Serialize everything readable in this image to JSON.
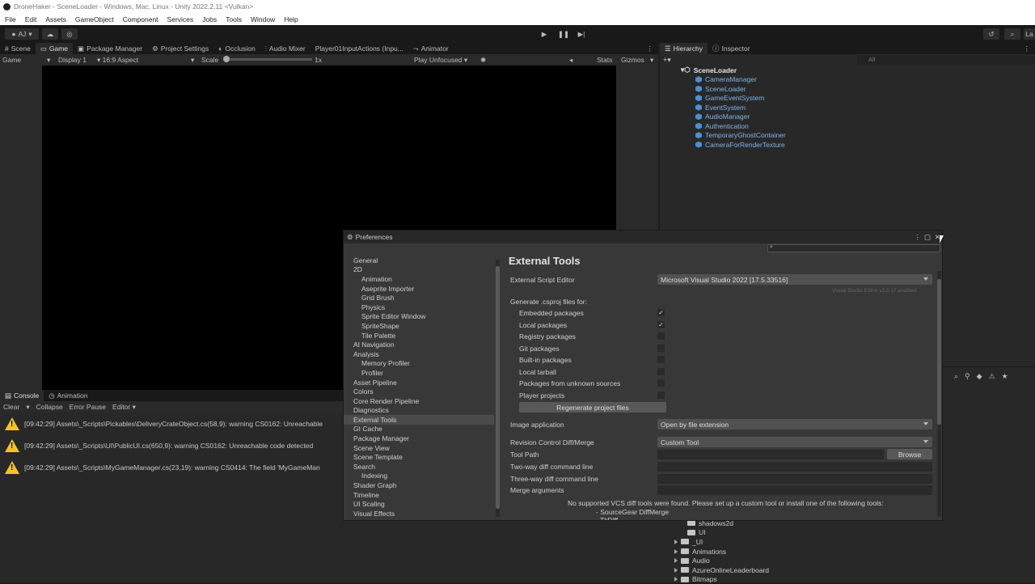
{
  "window": {
    "title": "DroneHaker - SceneLoader - Windows, Mac, Linux - Unity 2022.2.11 <Vulkan>"
  },
  "menu": [
    "File",
    "Edit",
    "Assets",
    "GameObject",
    "Component",
    "Services",
    "Jobs",
    "Tools",
    "Window",
    "Help"
  ],
  "toolbar": {
    "account": "AJ",
    "cloud_icon": "cloud-icon",
    "collab_icon": "collab-icon",
    "history_icon": "history-icon",
    "search_icon": "search-icon",
    "layers": "La"
  },
  "left_tabs": [
    {
      "label": "Scene",
      "icon": "scene-icon"
    },
    {
      "label": "Game",
      "icon": "game-icon"
    },
    {
      "label": "Package Manager",
      "icon": "package-icon"
    },
    {
      "label": "Project Settings",
      "icon": "gear-icon"
    },
    {
      "label": "Occlusion",
      "icon": "occlusion-icon"
    },
    {
      "label": "Audio Mixer",
      "icon": "mixer-icon"
    },
    {
      "label": "Player01InputActions (Inpu...",
      "icon": ""
    },
    {
      "label": "Animator",
      "icon": "animator-icon"
    }
  ],
  "game_bar": {
    "mode": "Game",
    "display": "Display 1",
    "aspect": "16:9 Aspect",
    "scale_label": "Scale",
    "scale_value": "1x",
    "play_mode": "Play Unfocused",
    "stats": "Stats",
    "gizmos": "Gizmos"
  },
  "hierarchy": {
    "tab": "Hierarchy",
    "inspector_tab": "Inspector",
    "search_placeholder": "All",
    "root": "SceneLoader",
    "items": [
      "CameraManager",
      "SceneLoader",
      "GameEventSystem",
      "EventSystem",
      "AudioManager",
      "Authentication",
      "TemporaryGhostContainer",
      "CameraForRenderTexture"
    ]
  },
  "console": {
    "tab": "Console",
    "animation_tab": "Animation",
    "clear": "Clear",
    "collapse": "Collapse",
    "error_pause": "Error Pause",
    "editor": "Editor",
    "lines": [
      "[09:42:29] Assets\\_Scripts\\Pickables\\DeliveryCrateObject.cs(58,9): warning CS0162: Unreachable",
      "[09:42:29] Assets\\_Scripts\\UI\\PublicUI.cs(650,9): warning CS0162: Unreachable code detected",
      "[09:42:29] Assets\\_Scripts\\MyGameManager.cs(23,19): warning CS0414: The field 'MyGameMan"
    ]
  },
  "project": {
    "items": [
      "shadows2d",
      "UI",
      "_UI",
      "Animations",
      "Audio",
      "AzureOnlineLeaderboard",
      "Bitmaps"
    ]
  },
  "preferences": {
    "title": "Preferences",
    "categories": [
      {
        "label": "General",
        "indent": false
      },
      {
        "label": "2D",
        "indent": false
      },
      {
        "label": "Animation",
        "indent": true
      },
      {
        "label": "Aseprite Importer",
        "indent": true
      },
      {
        "label": "Grid Brush",
        "indent": true
      },
      {
        "label": "Physics",
        "indent": true
      },
      {
        "label": "Sprite Editor Window",
        "indent": true
      },
      {
        "label": "SpriteShape",
        "indent": true
      },
      {
        "label": "Tile Palette",
        "indent": true
      },
      {
        "label": "AI Navigation",
        "indent": false
      },
      {
        "label": "Analysis",
        "indent": false
      },
      {
        "label": "Memory Profiler",
        "indent": true
      },
      {
        "label": "Profiler",
        "indent": true
      },
      {
        "label": "Asset Pipeline",
        "indent": false
      },
      {
        "label": "Colors",
        "indent": false
      },
      {
        "label": "Core Render Pipeline",
        "indent": false
      },
      {
        "label": "Diagnostics",
        "indent": false
      },
      {
        "label": "External Tools",
        "indent": false,
        "selected": true
      },
      {
        "label": "GI Cache",
        "indent": false
      },
      {
        "label": "Package Manager",
        "indent": false
      },
      {
        "label": "Scene View",
        "indent": false
      },
      {
        "label": "Scene Template",
        "indent": false
      },
      {
        "label": "Search",
        "indent": false
      },
      {
        "label": "Indexing",
        "indent": true
      },
      {
        "label": "Shader Graph",
        "indent": false
      },
      {
        "label": "Timeline",
        "indent": false
      },
      {
        "label": "UI Scaling",
        "indent": false
      },
      {
        "label": "Visual Effects",
        "indent": false
      }
    ],
    "heading": "External Tools",
    "script_editor_label": "External Script Editor",
    "script_editor_value": "Microsoft Visual Studio 2022 [17.5.33516]",
    "vs_version_note": "Visual Studio Editor v2.0.17 enabled",
    "generate_label": "Generate .csproj files for:",
    "csproj_options": [
      {
        "label": "Embedded packages",
        "checked": true
      },
      {
        "label": "Local packages",
        "checked": true
      },
      {
        "label": "Registry packages",
        "checked": false
      },
      {
        "label": "Git packages",
        "checked": false
      },
      {
        "label": "Built-in packages",
        "checked": false
      },
      {
        "label": "Local tarball",
        "checked": false
      },
      {
        "label": "Packages from unknown sources",
        "checked": false
      },
      {
        "label": "Player projects",
        "checked": false
      }
    ],
    "regenerate_button": "Regenerate project files",
    "image_app_label": "Image application",
    "image_app_value": "Open by file extension",
    "revision_label": "Revision Control Diff/Merge",
    "revision_value": "Custom Tool",
    "tool_path_label": "Tool Path",
    "browse_button": "Browse",
    "two_way_label": "Two-way diff command line",
    "three_way_label": "Three-way diff command line",
    "merge_args_label": "Merge arguments",
    "vcs_warning": "No supported VCS diff tools were found. Please set up a custom tool or install one of the following tools:",
    "vcs_tool_1": "- SourceGear DiffMerge",
    "vcs_tool_2": "- TkDiff"
  }
}
